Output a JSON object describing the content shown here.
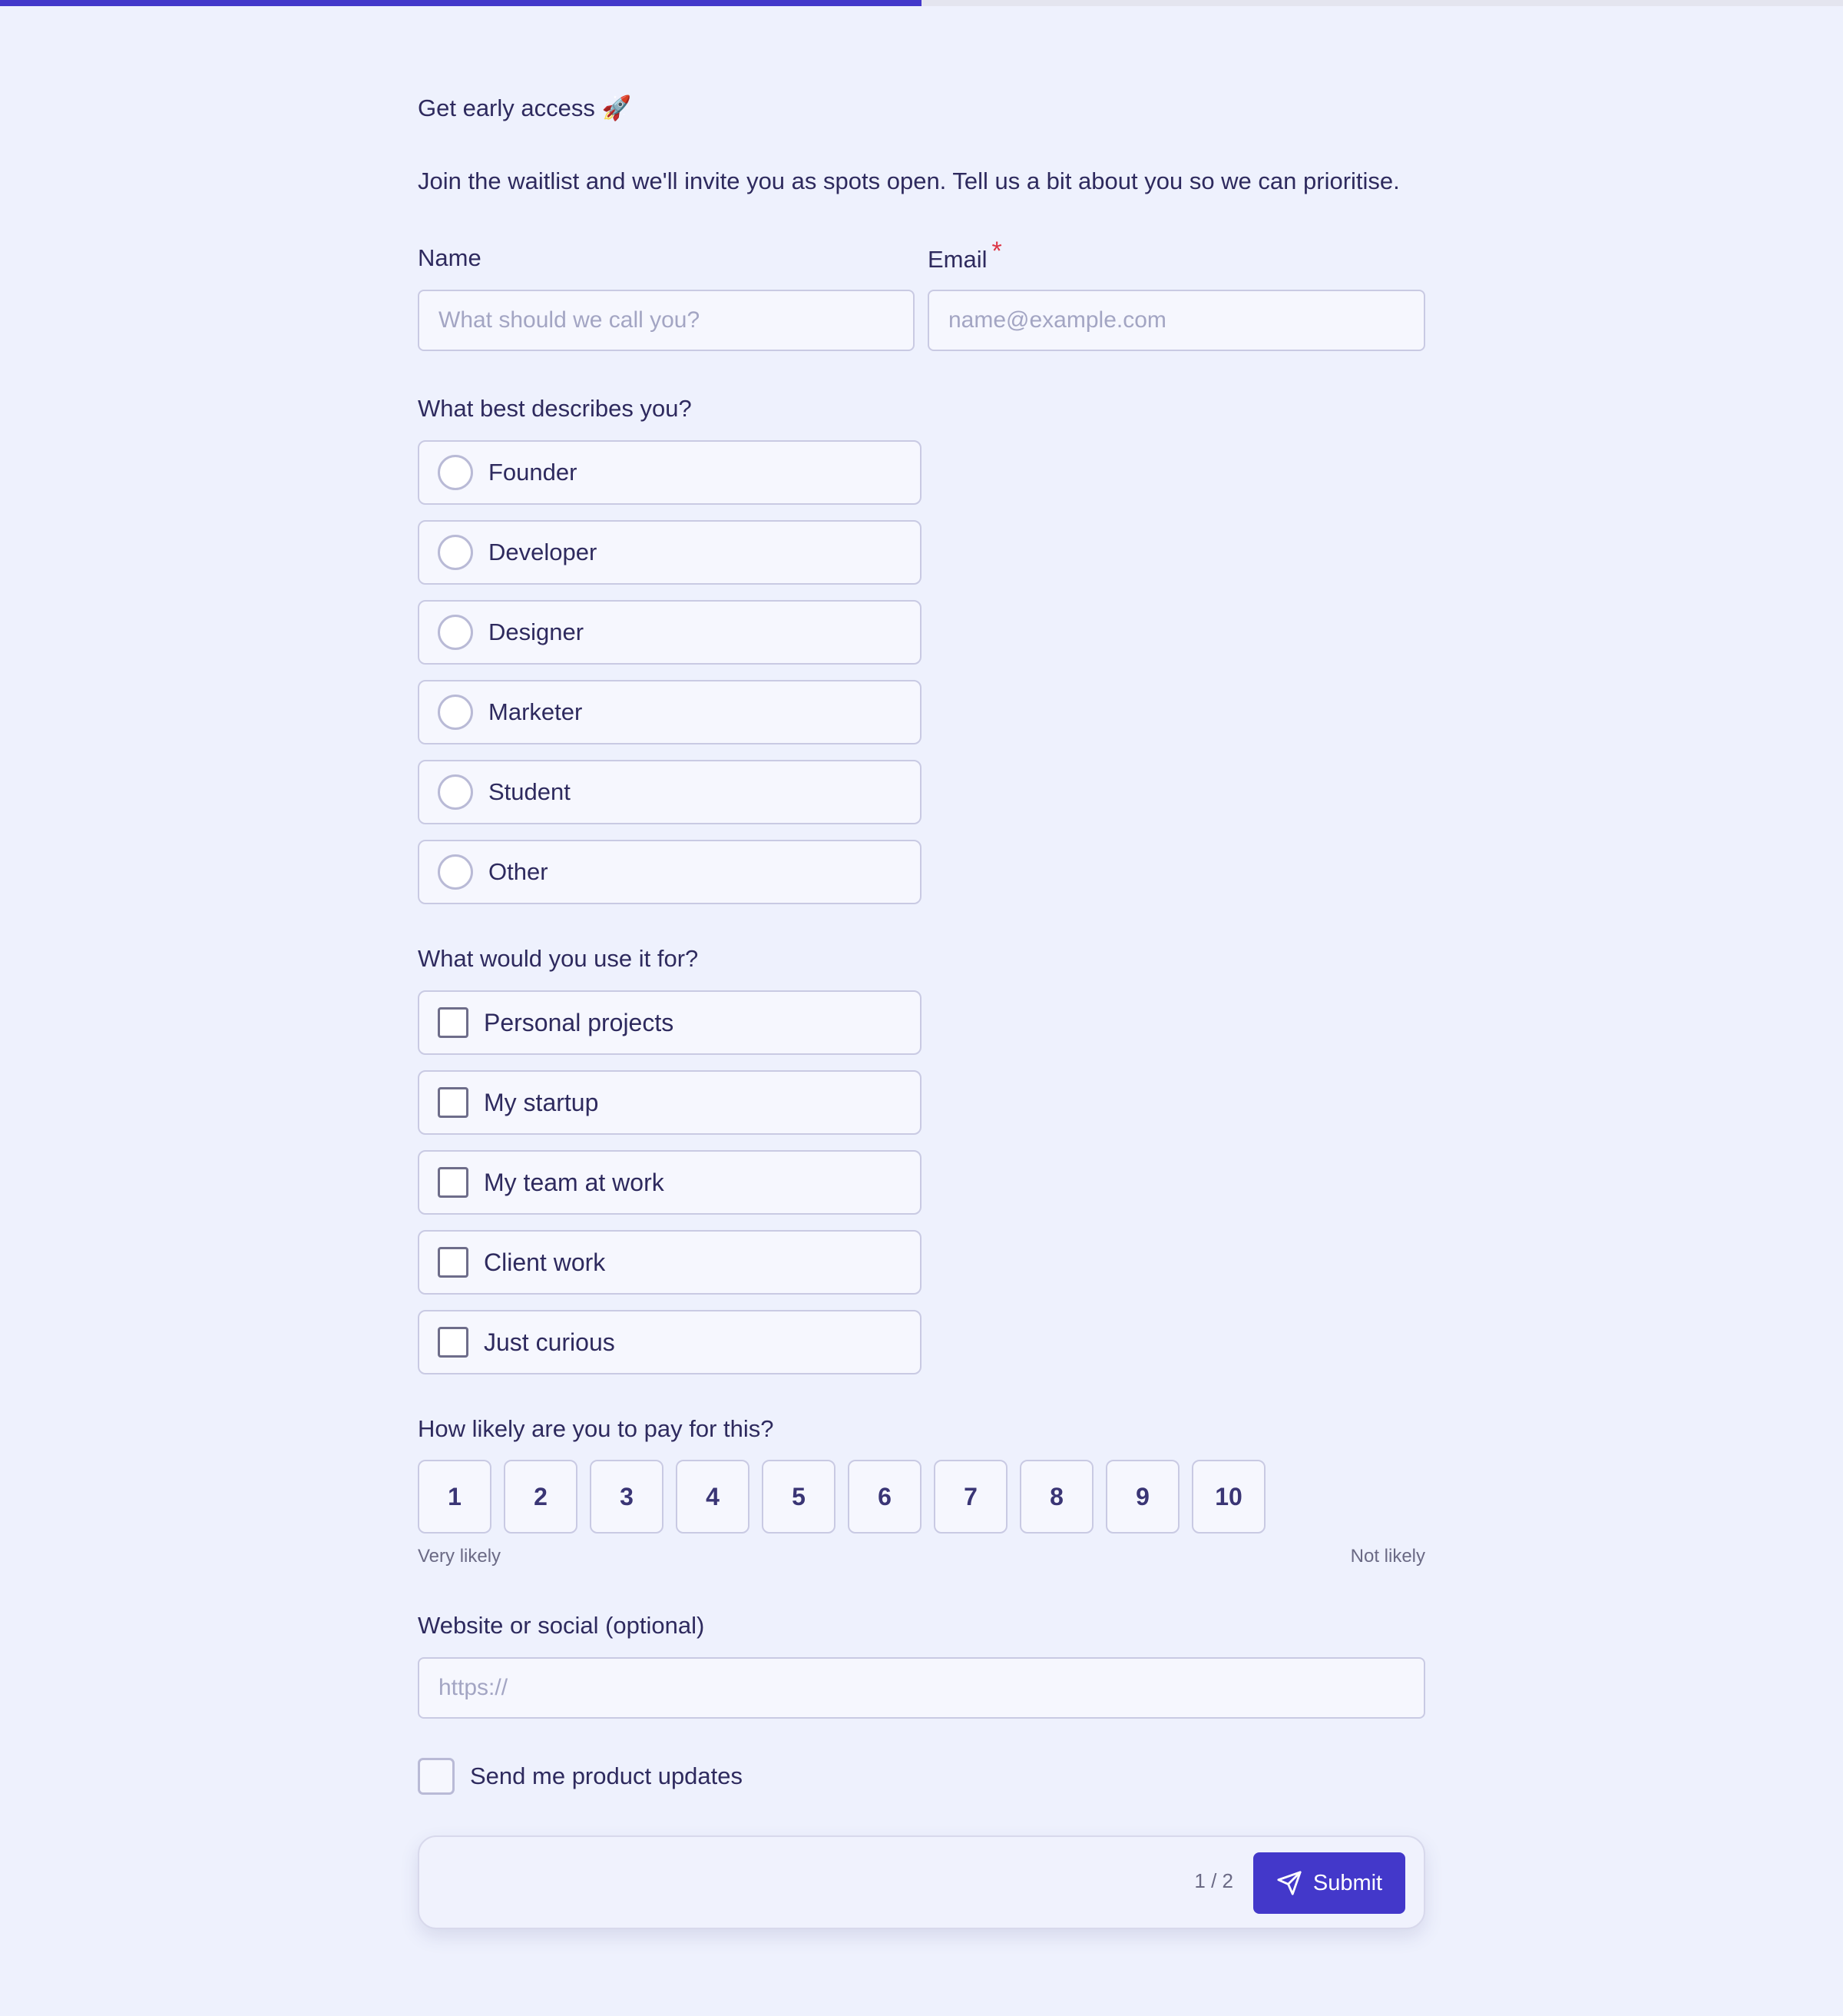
{
  "progress": {
    "fraction": 0.5
  },
  "form": {
    "title": "Get early access 🚀",
    "subtitle": "Join the waitlist and we'll invite you as spots open. Tell us a bit about you so we can prioritise.",
    "name": {
      "label": "Name",
      "placeholder": "What should we call you?"
    },
    "email": {
      "label": "Email",
      "required_marker": "*",
      "placeholder": "name@example.com"
    },
    "role": {
      "question": "What best describes you?",
      "options": [
        "Founder",
        "Developer",
        "Designer",
        "Marketer",
        "Student",
        "Other"
      ]
    },
    "usage": {
      "question": "What would you use it for?",
      "options": [
        "Personal projects",
        "My startup",
        "My team at work",
        "Client work",
        "Just curious"
      ]
    },
    "pay": {
      "question": "How likely are you to pay for this?",
      "scale": [
        "1",
        "2",
        "3",
        "4",
        "5",
        "6",
        "7",
        "8",
        "9",
        "10"
      ],
      "min_caption": "Very likely",
      "max_caption": "Not likely"
    },
    "website": {
      "label": "Website or social (optional)",
      "placeholder": "https://"
    },
    "updates": {
      "label": "Send me product updates"
    }
  },
  "footer": {
    "page_indicator": "1 / 2",
    "submit_label": "Submit",
    "submit_icon": "send-icon"
  },
  "colors": {
    "accent": "#4338ca",
    "required": "#dc3545",
    "background": "#eef1fd"
  }
}
